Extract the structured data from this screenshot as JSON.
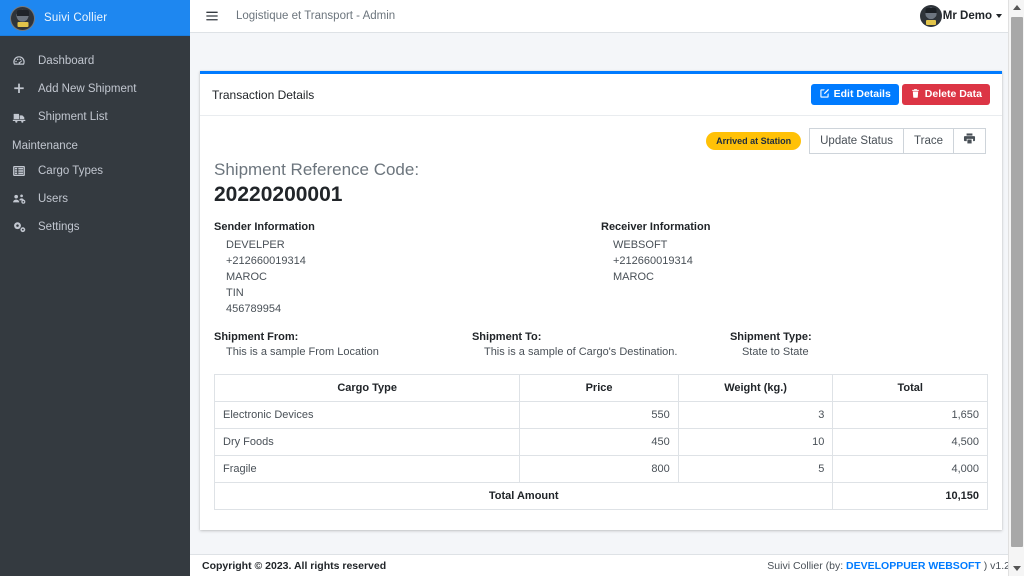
{
  "sidebar": {
    "brand": {
      "label": "Suivi Collier",
      "logo_icon": "user-avatar-icon"
    },
    "items": [
      {
        "label": "Dashboard",
        "icon": "dashboard-gauge-icon"
      },
      {
        "label": "Add New Shipment",
        "icon": "plus-icon"
      },
      {
        "label": "Shipment List",
        "icon": "truck-icon"
      }
    ],
    "section_header": "Maintenance",
    "maintenance_items": [
      {
        "label": "Cargo Types",
        "icon": "table-list-icon"
      },
      {
        "label": "Users",
        "icon": "users-cog-icon"
      },
      {
        "label": "Settings",
        "icon": "cogs-icon"
      }
    ]
  },
  "topbar": {
    "menu_icon": "hamburger-icon",
    "title": "Logistique et Transport - Admin",
    "user": "Mr Demo",
    "user_avatar_icon": "user-avatar-icon",
    "caret_icon": "caret-down-icon"
  },
  "card": {
    "title": "Transaction Details",
    "edit_button": "Edit Details",
    "edit_icon": "pencil-square-icon",
    "delete_button": "Delete Data",
    "delete_icon": "trash-icon"
  },
  "actions": {
    "status_badge": "Arrived at Station",
    "update_status": "Update Status",
    "trace": "Trace",
    "print_icon": "printer-icon"
  },
  "shipment": {
    "ref_label": "Shipment Reference Code:",
    "ref_code": "20220200001",
    "sender": {
      "heading": "Sender Information",
      "lines": [
        "DEVELPER",
        "+212660019314",
        "MAROC",
        "TIN",
        "456789954"
      ]
    },
    "receiver": {
      "heading": "Receiver Information",
      "lines": [
        "WEBSOFT",
        "+212660019314",
        "MAROC"
      ]
    },
    "from_label": "Shipment From:",
    "from_value": "This is a sample From Location",
    "to_label": "Shipment To:",
    "to_value": "This is a sample of Cargo's Destination.",
    "type_label": "Shipment Type:",
    "type_value": "State to State"
  },
  "table": {
    "columns": [
      "Cargo Type",
      "Price",
      "Weight (kg.)",
      "Total"
    ],
    "rows": [
      {
        "cargo": "Electronic Devices",
        "price": "550",
        "weight": "3",
        "total": "1,650"
      },
      {
        "cargo": "Dry Foods",
        "price": "450",
        "weight": "10",
        "total": "4,500"
      },
      {
        "cargo": "Fragile",
        "price": "800",
        "weight": "5",
        "total": "4,000"
      }
    ],
    "footer_label": "Total Amount",
    "footer_total": "10,150"
  },
  "footer": {
    "copyright": "Copyright © 2023. All rights reserved",
    "right_prefix": "Suivi Collier (by: ",
    "right_link": "DEVELOPPUER WEBSOFT",
    "right_suffix": " ) v1.2"
  },
  "colors": {
    "brand_blue": "#1e87f0",
    "primary": "#007bff",
    "danger": "#dc3545",
    "warning": "#ffc107",
    "sidebar_bg": "#343a40",
    "content_bg": "#f4f6f9"
  }
}
